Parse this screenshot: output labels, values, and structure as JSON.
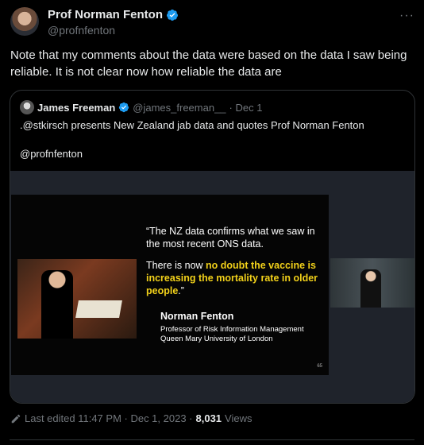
{
  "author": {
    "display_name": "Prof Norman Fenton",
    "handle": "@profnfenton"
  },
  "more_label": "···",
  "tweet_text": "Note that my comments about the data were based on the data I saw being reliable. It is not clear now how reliable the data are",
  "quoted": {
    "display_name": "James Freeman",
    "handle": "@james_freeman__",
    "date": "· Dec 1",
    "text_line1": ".@stkirsch presents New Zealand jab data and quotes Prof Norman Fenton",
    "text_line2": "@profnfenton",
    "slide": {
      "quote_line1": "“The NZ data confirms what we saw in the most recent ONS data.",
      "quote_pre": "There is now ",
      "quote_highlight": "no doubt the vaccine is increasing the mortality rate in older people",
      "quote_post": ".”",
      "speaker_name": "Norman Fenton",
      "speaker_title": "Professor of Risk Information Management",
      "speaker_org": "Queen Mary University of London",
      "slide_number": "65"
    }
  },
  "meta": {
    "edited": "Last edited 11:47 PM · Dec 1, 2023 ·",
    "views_count": "8,031",
    "views_label": "Views"
  },
  "colors": {
    "verified": "#1d9bf0",
    "highlight": "#f2d11a",
    "muted": "#71767b"
  }
}
